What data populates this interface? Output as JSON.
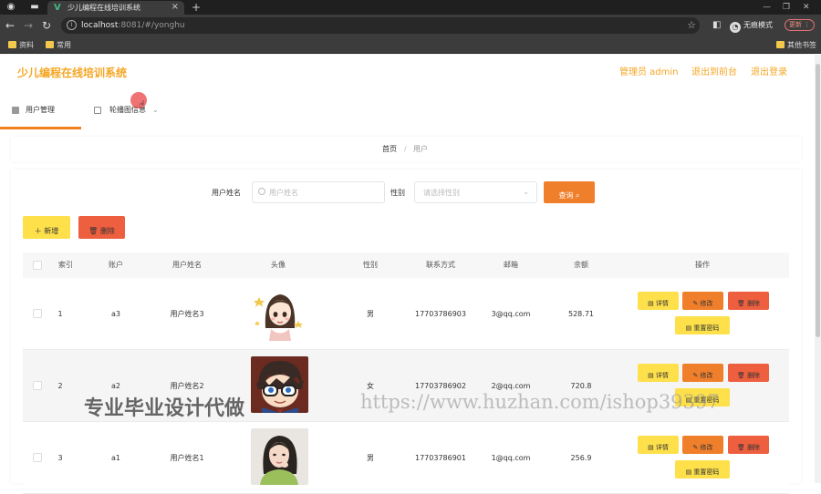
{
  "browser": {
    "tab_title": "少儿编程在线培训系统",
    "url_host": "localhost",
    "url_rest": ":8081/#/yonghu",
    "incognito_label": "无痕模式",
    "update_label": "更新",
    "bookmarks": [
      "资料",
      "常用"
    ],
    "other_bookmarks": "其他书签"
  },
  "app": {
    "title": "少儿编程在线培训系统",
    "admin_label": "管理员 admin",
    "back_front": "退出到前台",
    "logout": "退出登录"
  },
  "menu": [
    {
      "label": "用户管理",
      "active": true
    },
    {
      "label": "轮播图信息",
      "active": false
    }
  ],
  "breadcrumb": {
    "home": "首页",
    "sep": "/",
    "current": "用户"
  },
  "search": {
    "name_label": "用户姓名",
    "name_placeholder": "用户姓名",
    "gender_label": "性别",
    "gender_placeholder": "请选择性别",
    "query_button": "查询"
  },
  "actions": {
    "add": "＋ 新增",
    "delete": "删除"
  },
  "table": {
    "columns": [
      "索引",
      "账户",
      "用户姓名",
      "头像",
      "性别",
      "联系方式",
      "邮箱",
      "余额",
      "操作"
    ],
    "row_buttons": {
      "detail": "详情",
      "edit": "修改",
      "delete": "删除",
      "reset": "重置密码"
    },
    "rows": [
      {
        "index": "1",
        "account": "a3",
        "name": "用户姓名3",
        "gender": "男",
        "phone": "17703786903",
        "email": "3@qq.com",
        "balance": "528.71"
      },
      {
        "index": "2",
        "account": "a2",
        "name": "用户姓名2",
        "gender": "女",
        "phone": "17703786902",
        "email": "2@qq.com",
        "balance": "720.8"
      },
      {
        "index": "3",
        "account": "a1",
        "name": "用户姓名1",
        "gender": "男",
        "phone": "17703786901",
        "email": "1@qq.com",
        "balance": "256.9"
      }
    ]
  },
  "watermark": {
    "text_cn": "专业毕业设计代做",
    "text_url": "https://www.huzhan.com/ishop39397"
  },
  "colors": {
    "accent": "#f5a623",
    "orange": "#f07f2c",
    "yellow": "#fde04a",
    "red": "#ee5f3f"
  }
}
